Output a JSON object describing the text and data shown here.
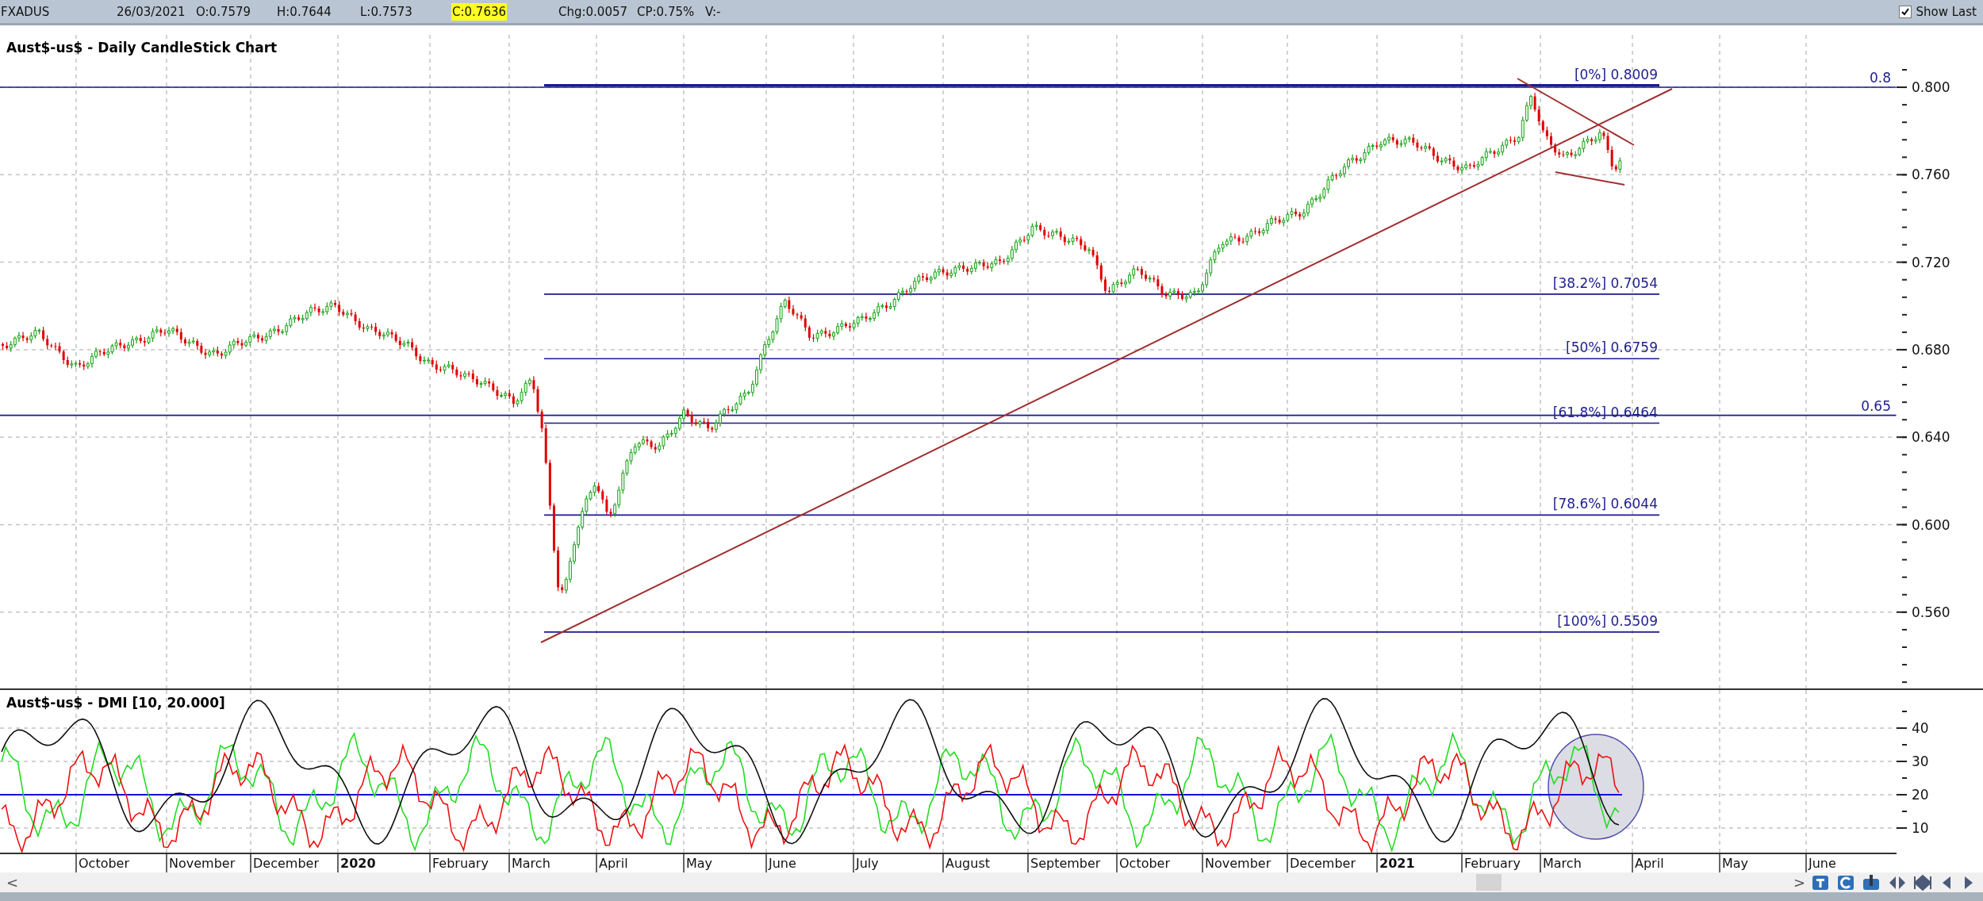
{
  "quote_bar": {
    "symbol": "FXADUS",
    "date": "26/03/2021",
    "open": "O:0.7579",
    "high": "H:0.7644",
    "low": "L:0.7573",
    "close": "C:0.7636",
    "change": "Chg:0.0057",
    "change_percent": "CP:0.75%",
    "volume": "V:-",
    "show_last": {
      "label": "Show Last",
      "checked": true
    }
  },
  "price_chart": {
    "title": "Aust$-us$ - Daily CandleStick Chart",
    "axis_ticks": [
      "0.800",
      "0.760",
      "0.720",
      "0.680",
      "0.640",
      "0.600",
      "0.560"
    ],
    "horizontal_lines": [
      {
        "label": "0.8"
      },
      {
        "label": "0.65"
      }
    ],
    "fibonacci_levels": [
      "[0%] 0.8009",
      "[38.2%] 0.7054",
      "[50%] 0.6759",
      "[61.8%] 0.6464",
      "[78.6%] 0.6044",
      "[100%] 0.5509"
    ]
  },
  "dmi_chart": {
    "title": "Aust$-us$ - DMI [10, 20.000]",
    "axis_ticks": [
      "40",
      "30",
      "20",
      "10"
    ]
  },
  "date_axis": [
    {
      "label": "October",
      "kind": "month"
    },
    {
      "label": "November",
      "kind": "month"
    },
    {
      "label": "December",
      "kind": "month"
    },
    {
      "label": "2020",
      "kind": "year"
    },
    {
      "label": "February",
      "kind": "month"
    },
    {
      "label": "March",
      "kind": "month"
    },
    {
      "label": "April",
      "kind": "month"
    },
    {
      "label": "May",
      "kind": "month"
    },
    {
      "label": "June",
      "kind": "month"
    },
    {
      "label": "July",
      "kind": "month"
    },
    {
      "label": "August",
      "kind": "month"
    },
    {
      "label": "September",
      "kind": "month"
    },
    {
      "label": "October",
      "kind": "month"
    },
    {
      "label": "November",
      "kind": "month"
    },
    {
      "label": "December",
      "kind": "month"
    },
    {
      "label": "2021",
      "kind": "year"
    },
    {
      "label": "February",
      "kind": "month"
    },
    {
      "label": "March",
      "kind": "month"
    },
    {
      "label": "April",
      "kind": "month"
    },
    {
      "label": "May",
      "kind": "month"
    },
    {
      "label": "June",
      "kind": "month"
    }
  ],
  "scroll_bar": {
    "left": "<",
    "right": ">"
  }
}
